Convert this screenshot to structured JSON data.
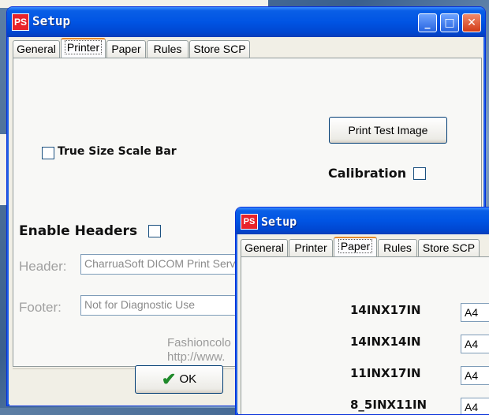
{
  "window1": {
    "title": "Setup",
    "app_icon": "PS",
    "controls": {
      "minimize": "_",
      "maximize": "□",
      "close": "✕"
    },
    "tabs": [
      "General",
      "Printer",
      "Paper",
      "Rules",
      "Store SCP"
    ],
    "active_tab": "Printer",
    "print_test_button": "Print Test Image",
    "true_size_label": "True Size Scale Bar",
    "calibration_label": "Calibration",
    "enable_headers_label": "Enable Headers",
    "header_label": "Header:",
    "header_value": "CharruaSoft DICOM Print Server",
    "footer_label": "Footer:",
    "footer_value": "Not for Diagnostic Use",
    "credits_line1": "Fashioncolo",
    "credits_line2": "http://www.",
    "ok_button": "OK",
    "ok_icon": "checkmark-icon"
  },
  "window2": {
    "title": "Setup",
    "app_icon": "PS",
    "tabs": [
      "General",
      "Printer",
      "Paper",
      "Rules",
      "Store SCP"
    ],
    "active_tab": "Paper",
    "paper_sizes": [
      {
        "name": "14INX17IN",
        "value": "A4"
      },
      {
        "name": "14INX14IN",
        "value": "A4"
      },
      {
        "name": "11INX17IN",
        "value": "A4"
      },
      {
        "name": "8_5INX11IN",
        "value": "A4"
      }
    ]
  },
  "colors": {
    "title_bar": "#0054e3",
    "close_button": "#d23b16",
    "tab_highlight": "#e68b2c"
  }
}
